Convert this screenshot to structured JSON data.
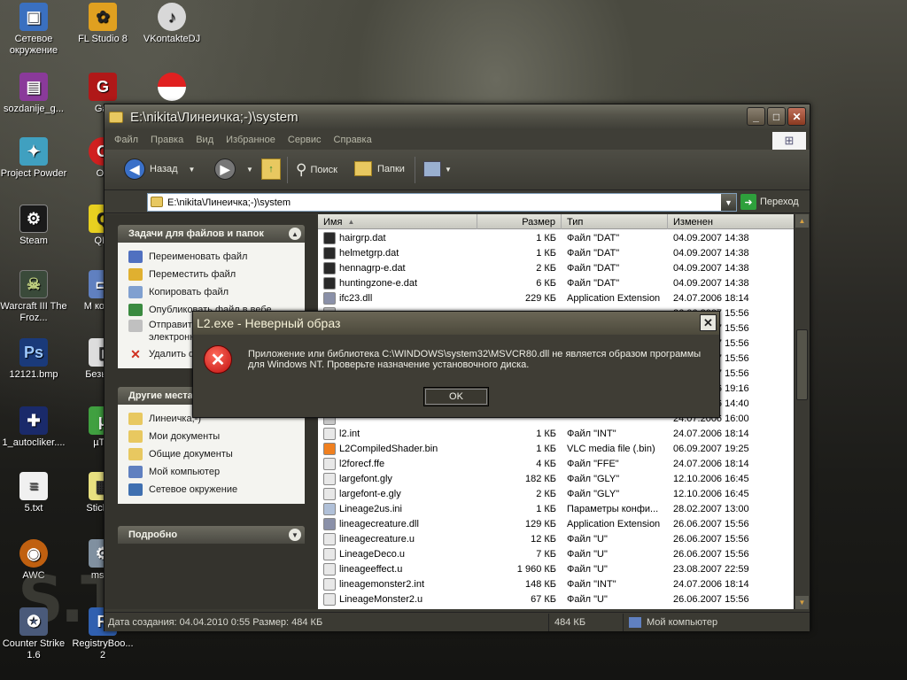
{
  "desktop": {
    "icons": [
      {
        "label": "Сетевое окружение",
        "icon": "network-icon"
      },
      {
        "label": "FL Studio 8",
        "icon": "fl-studio-icon"
      },
      {
        "label": "VKontakteDJ",
        "icon": "vkontaktedj-icon"
      },
      {
        "label": "sozdanije_g...",
        "icon": "winrar-archive-icon"
      },
      {
        "label": "Gar",
        "icon": "garena-icon"
      },
      {
        "label": "",
        "icon": "pokeball-icon"
      },
      {
        "label": "Project Powder",
        "icon": "project-powder-icon"
      },
      {
        "label": "Op",
        "icon": "opera-icon"
      },
      {
        "label": "Steam",
        "icon": "steam-icon"
      },
      {
        "label": "QIP",
        "icon": "qip-icon"
      },
      {
        "label": "Warcraft III The Froz...",
        "icon": "warcraft-icon"
      },
      {
        "label": "M компь",
        "icon": "my-computer-shortcut-icon"
      },
      {
        "label": "12121.bmp",
        "icon": "psd-file-icon"
      },
      {
        "label": "Безымя",
        "icon": "untitled-file-icon"
      },
      {
        "label": "1_autocliker....",
        "icon": "autoclicker-icon"
      },
      {
        "label": "µTor",
        "icon": "utorrent-icon"
      },
      {
        "label": "5.txt",
        "icon": "text-file-icon"
      },
      {
        "label": "StickyN",
        "icon": "sticky-notes-icon"
      },
      {
        "label": "AWC",
        "icon": "awc-icon"
      },
      {
        "label": "msco",
        "icon": "msconfig-icon"
      },
      {
        "label": "Counter Strike 1.6",
        "icon": "counter-strike-icon"
      },
      {
        "label": "RegistryBoo... 2",
        "icon": "registry-booster-icon"
      }
    ],
    "wallpaper_logo": "S.T."
  },
  "window": {
    "title": "E:\\nikita\\Линеичка;-)\\system",
    "menu": [
      "Файл",
      "Правка",
      "Вид",
      "Избранное",
      "Сервис",
      "Справка"
    ],
    "toolbar": {
      "back": "Назад",
      "search": "Поиск",
      "folders": "Папки"
    },
    "address": {
      "value": "E:\\nikita\\Линеичка;-)\\system",
      "go": "Переход"
    },
    "tasks_panel": {
      "title": "Задачи для файлов и папок",
      "items": [
        {
          "label": "Переименовать файл",
          "icon": "rename-icon",
          "color": "#5070c0"
        },
        {
          "label": "Переместить файл",
          "icon": "move-file-icon",
          "color": "#e0b030"
        },
        {
          "label": "Копировать файл",
          "icon": "copy-file-icon",
          "color": "#80a0d0"
        },
        {
          "label": "Опубликовать файл в вебе",
          "icon": "publish-web-icon",
          "color": "#3a8a40"
        },
        {
          "label": "Отправить этот файл по электронной почте",
          "icon": "email-icon",
          "color": "#c0c0c0"
        },
        {
          "label": "Удалить файл",
          "icon": "delete-icon",
          "color": "#d03020"
        }
      ]
    },
    "places_panel": {
      "title": "Другие места",
      "items": [
        {
          "label": "Линеичка;-)",
          "icon": "folder-icon",
          "color": "#e8c860"
        },
        {
          "label": "Мои документы",
          "icon": "my-documents-icon",
          "color": "#e8c860"
        },
        {
          "label": "Общие документы",
          "icon": "shared-documents-icon",
          "color": "#e8c860"
        },
        {
          "label": "Мой компьютер",
          "icon": "my-computer-icon",
          "color": "#6080c0"
        },
        {
          "label": "Сетевое окружение",
          "icon": "network-icon",
          "color": "#4070b0"
        }
      ]
    },
    "details_panel": {
      "title": "Подробно"
    },
    "columns": {
      "name": "Имя",
      "size": "Размер",
      "type": "Тип",
      "modified": "Изменен"
    },
    "files": [
      {
        "name": "hairgrp.dat",
        "size": "1 КБ",
        "type": "Файл \"DAT\"",
        "date": "04.09.2007 14:38",
        "icon": "dat-file-icon"
      },
      {
        "name": "helmetgrp.dat",
        "size": "1 КБ",
        "type": "Файл \"DAT\"",
        "date": "04.09.2007 14:38",
        "icon": "dat-file-icon"
      },
      {
        "name": "hennagrp-e.dat",
        "size": "2 КБ",
        "type": "Файл \"DAT\"",
        "date": "04.09.2007 14:38",
        "icon": "dat-file-icon"
      },
      {
        "name": "huntingzone-e.dat",
        "size": "6 КБ",
        "type": "Файл \"DAT\"",
        "date": "04.09.2007 14:38",
        "icon": "dat-file-icon"
      },
      {
        "name": "ifc23.dll",
        "size": "229 КБ",
        "type": "Application Extension",
        "date": "24.07.2006 18:14",
        "icon": "dll-file-icon"
      },
      {
        "name": "",
        "size": "",
        "type": "",
        "date": "26.06.2007 15:56",
        "icon": "file-icon"
      },
      {
        "name": "",
        "size": "",
        "type": "",
        "date": "26.06.2007 15:56",
        "icon": "file-icon"
      },
      {
        "name": "",
        "size": "",
        "type": "",
        "date": "26.06.2007 15:56",
        "icon": "file-icon"
      },
      {
        "name": "",
        "size": "",
        "type": "",
        "date": "26.06.2007 15:56",
        "icon": "file-icon"
      },
      {
        "name": "",
        "size": "",
        "type": "",
        "date": "26.06.2007 15:56",
        "icon": "file-icon"
      },
      {
        "name": "",
        "size": "",
        "type": "",
        "date": "24.07.2006 19:16",
        "icon": "file-icon"
      },
      {
        "name": "",
        "size": "",
        "type": "",
        "date": "24.07.2006 14:40",
        "icon": "file-icon"
      },
      {
        "name": "",
        "size": "",
        "type": "",
        "date": "24.07.2006 16:00",
        "icon": "file-icon"
      },
      {
        "name": "l2.int",
        "size": "1 КБ",
        "type": "Файл \"INT\"",
        "date": "24.07.2006 18:14",
        "icon": "int-file-icon"
      },
      {
        "name": "L2CompiledShader.bin",
        "size": "1 КБ",
        "type": "VLC media file (.bin)",
        "date": "06.09.2007 19:25",
        "icon": "vlc-file-icon"
      },
      {
        "name": "l2forecf.ffe",
        "size": "4 КБ",
        "type": "Файл \"FFE\"",
        "date": "24.07.2006 18:14",
        "icon": "ffe-file-icon"
      },
      {
        "name": "largefont.gly",
        "size": "182 КБ",
        "type": "Файл \"GLY\"",
        "date": "12.10.2006 16:45",
        "icon": "gly-file-icon"
      },
      {
        "name": "largefont-e.gly",
        "size": "2 КБ",
        "type": "Файл \"GLY\"",
        "date": "12.10.2006 16:45",
        "icon": "gly-file-icon"
      },
      {
        "name": "Lineage2us.ini",
        "size": "1 КБ",
        "type": "Параметры конфи...",
        "date": "28.02.2007 13:00",
        "icon": "ini-file-icon"
      },
      {
        "name": "lineagecreature.dll",
        "size": "129 КБ",
        "type": "Application Extension",
        "date": "26.06.2007 15:56",
        "icon": "dll-file-icon"
      },
      {
        "name": "lineagecreature.u",
        "size": "12 КБ",
        "type": "Файл \"U\"",
        "date": "26.06.2007 15:56",
        "icon": "u-file-icon"
      },
      {
        "name": "LineageDeco.u",
        "size": "7 КБ",
        "type": "Файл \"U\"",
        "date": "26.06.2007 15:56",
        "icon": "u-file-icon"
      },
      {
        "name": "lineageeffect.u",
        "size": "1 960 КБ",
        "type": "Файл \"U\"",
        "date": "23.08.2007 22:59",
        "icon": "u-file-icon"
      },
      {
        "name": "lineagemonster2.int",
        "size": "148 КБ",
        "type": "Файл \"INT\"",
        "date": "24.07.2006 18:14",
        "icon": "int-file-icon"
      },
      {
        "name": "LineageMonster2.u",
        "size": "67 КБ",
        "type": "Файл \"U\"",
        "date": "26.06.2007 15:56",
        "icon": "u-file-icon"
      }
    ],
    "status": {
      "details": "Дата создания: 04.04.2010 0:55 Размер: 484 КБ",
      "size": "484 КБ",
      "location": "Мой компьютер"
    }
  },
  "dialog": {
    "title": "L2.exe - Неверный образ",
    "message": "Приложение или библиотека C:\\WINDOWS\\system32\\MSVCR80.dll не является образом программы для Windows NT. Проверьте назначение установочного диска.",
    "ok": "OK",
    "icon": "error-icon"
  },
  "colors": {
    "accent": "#e8c860",
    "error": "#c01010",
    "theme": "#3b3a33"
  }
}
